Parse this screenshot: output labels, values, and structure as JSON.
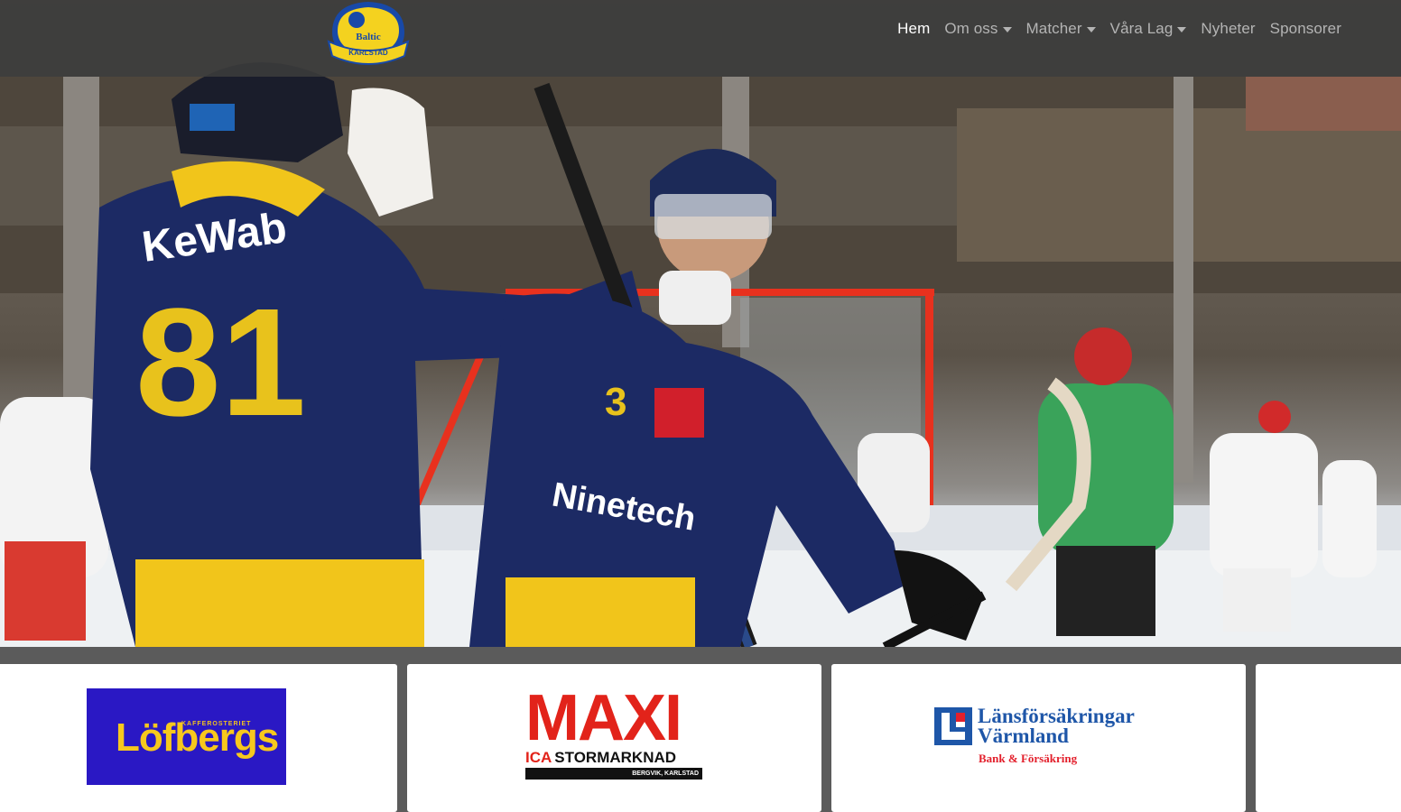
{
  "nav": {
    "items": [
      {
        "label": "Hem",
        "active": true,
        "dropdown": false
      },
      {
        "label": "Om oss",
        "active": false,
        "dropdown": true
      },
      {
        "label": "Matcher",
        "active": false,
        "dropdown": true
      },
      {
        "label": "Våra Lag",
        "active": false,
        "dropdown": true
      },
      {
        "label": "Nyheter",
        "active": false,
        "dropdown": false
      },
      {
        "label": "Sponsorer",
        "active": false,
        "dropdown": false
      }
    ]
  },
  "logo": {
    "line1": "Baltic",
    "line2": "KARLSTAD"
  },
  "hero": {
    "image": "bandy-players-celebrating"
  },
  "sponsors": [
    {
      "name": "Löfbergs",
      "tagline": "KAFFEROSTERIET",
      "bg": "#2a18c4",
      "color": "#f7c81d"
    },
    {
      "name": "MAXI",
      "sub_a": "ICA",
      "sub_b": "STORMARKNAD",
      "location": "BERGVIK, KARLSTAD",
      "color": "#e2231a"
    },
    {
      "name_line1": "Länsförsäkringar",
      "name_line2": "Värmland",
      "tagline": "Bank & Försäkring",
      "color": "#1e56a8",
      "accent": "#e3202c"
    }
  ],
  "colors": {
    "navbar": "#3a3a3a",
    "strip": "#5b5b5b"
  }
}
